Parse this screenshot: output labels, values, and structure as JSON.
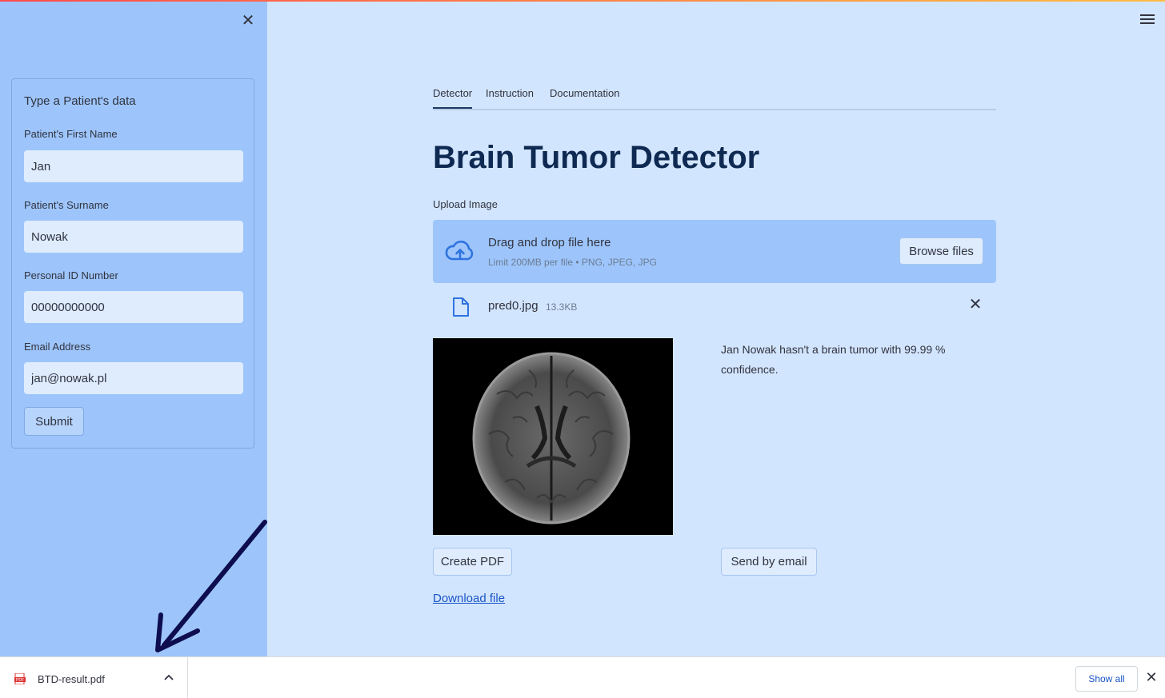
{
  "sidebar": {
    "close_icon": "close-icon",
    "form_title": "Type a Patient's data",
    "fields": [
      {
        "label": "Patient's First Name",
        "value": "Jan"
      },
      {
        "label": "Patient's Surname",
        "value": "Nowak"
      },
      {
        "label": "Personal ID Number",
        "value": "00000000000"
      },
      {
        "label": "Email Address",
        "value": "jan@nowak.pl"
      }
    ],
    "submit_label": "Submit"
  },
  "menu_icon": "hamburger-menu-icon",
  "tabs": [
    {
      "label": "Detector",
      "active": true
    },
    {
      "label": "Instruction",
      "active": false
    },
    {
      "label": "Documentation",
      "active": false
    }
  ],
  "main": {
    "title": "Brain Tumor Detector",
    "upload_label": "Upload Image",
    "dropzone": {
      "icon": "cloud-upload-icon",
      "main_text": "Drag and drop file here",
      "sub_text": "Limit 200MB per file • PNG, JPEG, JPG",
      "browse_label": "Browse files"
    },
    "uploaded_file": {
      "icon": "file-icon",
      "name": "pred0.jpg",
      "size": "13.3KB"
    },
    "result": "Jan Nowak hasn't a brain tumor with 99.99 % confidence.",
    "create_pdf_label": "Create PDF",
    "send_email_label": "Send by email",
    "download_link": "Download file"
  },
  "download_bar": {
    "file_icon": "pdf-icon",
    "file_name": "BTD-result.pdf",
    "show_all_label": "Show all"
  },
  "colors": {
    "sidebar_bg": "#9dc5fb",
    "main_bg": "#d2e5fe",
    "title": "#0f2a52",
    "link": "#1a55c7",
    "arrow": "#0d0d4f"
  }
}
